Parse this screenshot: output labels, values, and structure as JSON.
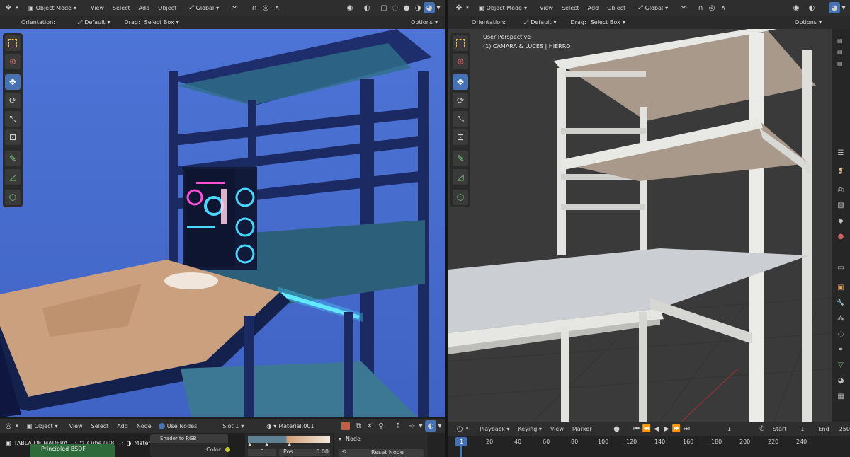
{
  "left_viewport": {
    "header": {
      "mode": "Object Mode",
      "menus": [
        "View",
        "Select",
        "Add",
        "Object"
      ],
      "transform": "Global"
    },
    "toolsettings": {
      "orientation_label": "Orientation:",
      "orientation_value": "Default",
      "drag_label": "Drag:",
      "drag_value": "Select Box",
      "options": "Options"
    }
  },
  "right_viewport": {
    "header": {
      "mode": "Object Mode",
      "menus": [
        "View",
        "Select",
        "Add",
        "Object"
      ],
      "transform": "Global"
    },
    "toolsettings": {
      "orientation_label": "Orientation:",
      "orientation_value": "Default",
      "drag_label": "Drag:",
      "drag_value": "Select Box",
      "options": "Options"
    },
    "overlay": {
      "perspective": "User Perspective",
      "collection": "(1) CAMARA & LUCES | HIERRO"
    }
  },
  "node_editor": {
    "header": {
      "mode": "Object",
      "menus": [
        "View",
        "Select",
        "Add",
        "Node"
      ],
      "use_nodes": "Use Nodes",
      "slot": "Slot 1",
      "material": "Material.001"
    },
    "breadcrumb": {
      "scene": "TABLA DE MADERA",
      "object": "Cube.008",
      "material": "Material.001"
    },
    "nodes": {
      "principled": "Principled BSDF",
      "shader_to_rgb": "Shader to RGB",
      "color_socket": "Color"
    },
    "ramp": {
      "index": "0",
      "pos_label": "Pos",
      "pos_value": "0.00"
    },
    "sidebar": {
      "panel": "Node",
      "reset": "Reset Node"
    }
  },
  "timeline": {
    "menus": [
      "Playback",
      "Keying",
      "View",
      "Marker"
    ],
    "current_frame": "1",
    "start_label": "Start",
    "start_value": "1",
    "end_label": "End",
    "end_value": "250",
    "ruler": [
      "1",
      "20",
      "40",
      "60",
      "80",
      "100",
      "120",
      "140",
      "160",
      "180",
      "200",
      "220",
      "240"
    ]
  },
  "colors": {
    "accent": "#4772b3",
    "header": "#2e2e2e",
    "viewport_left": "#4a6fd0",
    "viewport_right": "#3d3d3d"
  }
}
